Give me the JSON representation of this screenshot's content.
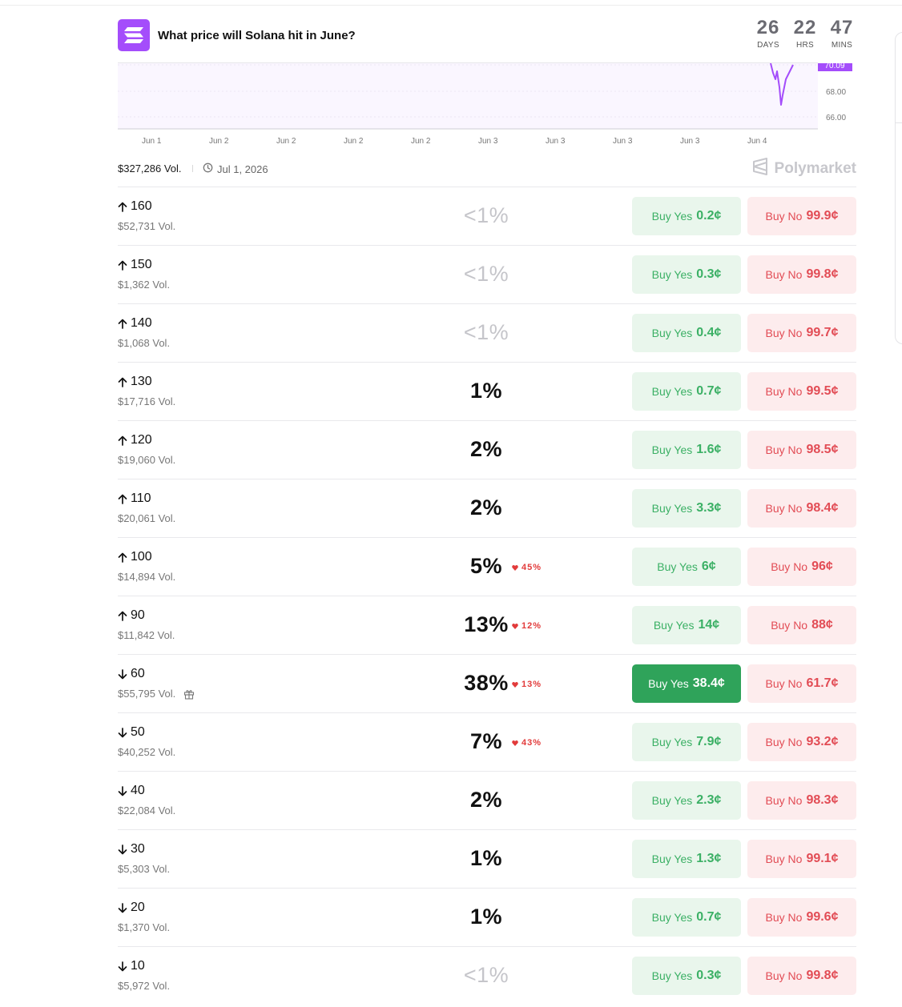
{
  "market": {
    "title": "What price will Solana hit in June?",
    "countdown": [
      {
        "value": "26",
        "label": "DAYS"
      },
      {
        "value": "22",
        "label": "HRS"
      },
      {
        "value": "47",
        "label": "MINS"
      }
    ],
    "volume": "$327,286 Vol.",
    "end_date": "Jul 1, 2026",
    "brand": "Polymarket"
  },
  "colors": {
    "accent": "#a44dfb",
    "yes": "#3bb065",
    "yes_bg": "#e9f6ec",
    "yes_active": "#2fa35a",
    "no": "#e24c55",
    "no_bg": "#fdeced",
    "change": "#e23b3b"
  },
  "chart_data": {
    "type": "line",
    "x_ticks": [
      "Jun 1",
      "Jun 2",
      "Jun 2",
      "Jun 2",
      "Jun 2",
      "Jun 3",
      "Jun 3",
      "Jun 3",
      "Jun 3",
      "Jun 4"
    ],
    "y_ticks": [
      "70.09",
      "68.00",
      "66.00"
    ],
    "current_label": "70.09",
    "series_color": "#a44dfb",
    "grid": true
  },
  "outcomes": [
    {
      "direction": "up",
      "label": "160",
      "volume": "$52,731 Vol.",
      "chance": "<1%",
      "low": true,
      "change": "",
      "yes_text": "Buy Yes",
      "yes_price": "0.2¢",
      "no_text": "Buy No",
      "no_price": "99.9¢"
    },
    {
      "direction": "up",
      "label": "150",
      "volume": "$1,362 Vol.",
      "chance": "<1%",
      "low": true,
      "change": "",
      "yes_text": "Buy Yes",
      "yes_price": "0.3¢",
      "no_text": "Buy No",
      "no_price": "99.8¢"
    },
    {
      "direction": "up",
      "label": "140",
      "volume": "$1,068 Vol.",
      "chance": "<1%",
      "low": true,
      "change": "",
      "yes_text": "Buy Yes",
      "yes_price": "0.4¢",
      "no_text": "Buy No",
      "no_price": "99.7¢"
    },
    {
      "direction": "up",
      "label": "130",
      "volume": "$17,716 Vol.",
      "chance": "1%",
      "low": false,
      "change": "",
      "yes_text": "Buy Yes",
      "yes_price": "0.7¢",
      "no_text": "Buy No",
      "no_price": "99.5¢"
    },
    {
      "direction": "up",
      "label": "120",
      "volume": "$19,060 Vol.",
      "chance": "2%",
      "low": false,
      "change": "",
      "yes_text": "Buy Yes",
      "yes_price": "1.6¢",
      "no_text": "Buy No",
      "no_price": "98.5¢"
    },
    {
      "direction": "up",
      "label": "110",
      "volume": "$20,061 Vol.",
      "chance": "2%",
      "low": false,
      "change": "",
      "yes_text": "Buy Yes",
      "yes_price": "3.3¢",
      "no_text": "Buy No",
      "no_price": "98.4¢"
    },
    {
      "direction": "up",
      "label": "100",
      "volume": "$14,894 Vol.",
      "chance": "5%",
      "low": false,
      "change": "45%",
      "yes_text": "Buy Yes",
      "yes_price": "6¢",
      "no_text": "Buy No",
      "no_price": "96¢"
    },
    {
      "direction": "up",
      "label": "90",
      "volume": "$11,842 Vol.",
      "chance": "13%",
      "low": false,
      "change": "12%",
      "yes_text": "Buy Yes",
      "yes_price": "14¢",
      "no_text": "Buy No",
      "no_price": "88¢"
    },
    {
      "direction": "down",
      "label": "60",
      "volume": "$55,795 Vol.",
      "gift": true,
      "chance": "38%",
      "low": false,
      "change": "13%",
      "active": true,
      "yes_text": "Buy Yes",
      "yes_price": "38.4¢",
      "no_text": "Buy No",
      "no_price": "61.7¢"
    },
    {
      "direction": "down",
      "label": "50",
      "volume": "$40,252 Vol.",
      "chance": "7%",
      "low": false,
      "change": "43%",
      "yes_text": "Buy Yes",
      "yes_price": "7.9¢",
      "no_text": "Buy No",
      "no_price": "93.2¢"
    },
    {
      "direction": "down",
      "label": "40",
      "volume": "$22,084 Vol.",
      "chance": "2%",
      "low": false,
      "change": "",
      "yes_text": "Buy Yes",
      "yes_price": "2.3¢",
      "no_text": "Buy No",
      "no_price": "98.3¢"
    },
    {
      "direction": "down",
      "label": "30",
      "volume": "$5,303 Vol.",
      "chance": "1%",
      "low": false,
      "change": "",
      "yes_text": "Buy Yes",
      "yes_price": "1.3¢",
      "no_text": "Buy No",
      "no_price": "99.1¢"
    },
    {
      "direction": "down",
      "label": "20",
      "volume": "$1,370 Vol.",
      "chance": "1%",
      "low": false,
      "change": "",
      "yes_text": "Buy Yes",
      "yes_price": "0.7¢",
      "no_text": "Buy No",
      "no_price": "99.6¢"
    },
    {
      "direction": "down",
      "label": "10",
      "volume": "$5,972 Vol.",
      "chance": "<1%",
      "low": true,
      "change": "",
      "yes_text": "Buy Yes",
      "yes_price": "0.3¢",
      "no_text": "Buy No",
      "no_price": "99.8¢"
    }
  ]
}
